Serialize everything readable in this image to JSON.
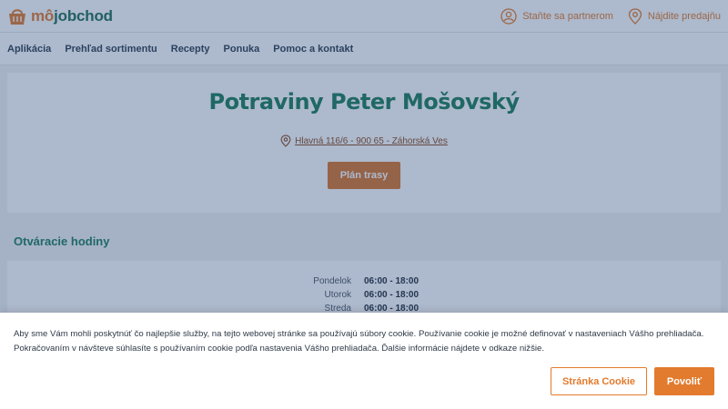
{
  "header": {
    "logo_text_prefix": "mô",
    "logo_text_suffix": "jobchod",
    "partner_link": "Staňte sa partnerom",
    "find_store_link": "Nájdite predajňu"
  },
  "nav": {
    "items": [
      {
        "label": "Aplikácia"
      },
      {
        "label": "Prehľad sortimentu"
      },
      {
        "label": "Recepty"
      },
      {
        "label": "Ponuka"
      },
      {
        "label": "Pomoc a kontakt"
      }
    ]
  },
  "store": {
    "title": "Potraviny Peter Mošovský",
    "address": "Hlavná 116/6 - 900 65 - Záhorská Ves",
    "route_button": "Plán trasy"
  },
  "hours": {
    "heading": "Otváracie hodiny",
    "rows": [
      {
        "day": "Pondelok",
        "time": "06:00 - 18:00"
      },
      {
        "day": "Utorok",
        "time": "06:00 - 18:00"
      },
      {
        "day": "Streda",
        "time": "06:00 - 18:00"
      }
    ]
  },
  "cookie": {
    "text": "Aby sme Vám mohli poskytnúť čo najlepšie služby, na tejto webovej stránke sa používajú súbory cookie. Používanie cookie je možné definovať v nastaveniach Vášho prehliadača. Pokračovaním v návšteve súhlasíte s používaním cookie podľa nastavenia Vášho prehliadača. Ďalšie informácie nájdete v odkaze nižšie.",
    "settings_button": "Stránka Cookie",
    "accept_button": "Povoliť"
  },
  "colors": {
    "brand_green": "#1b7d5b",
    "brand_orange": "#e27b2d",
    "overlay": "rgba(40,70,120,0.38)"
  }
}
